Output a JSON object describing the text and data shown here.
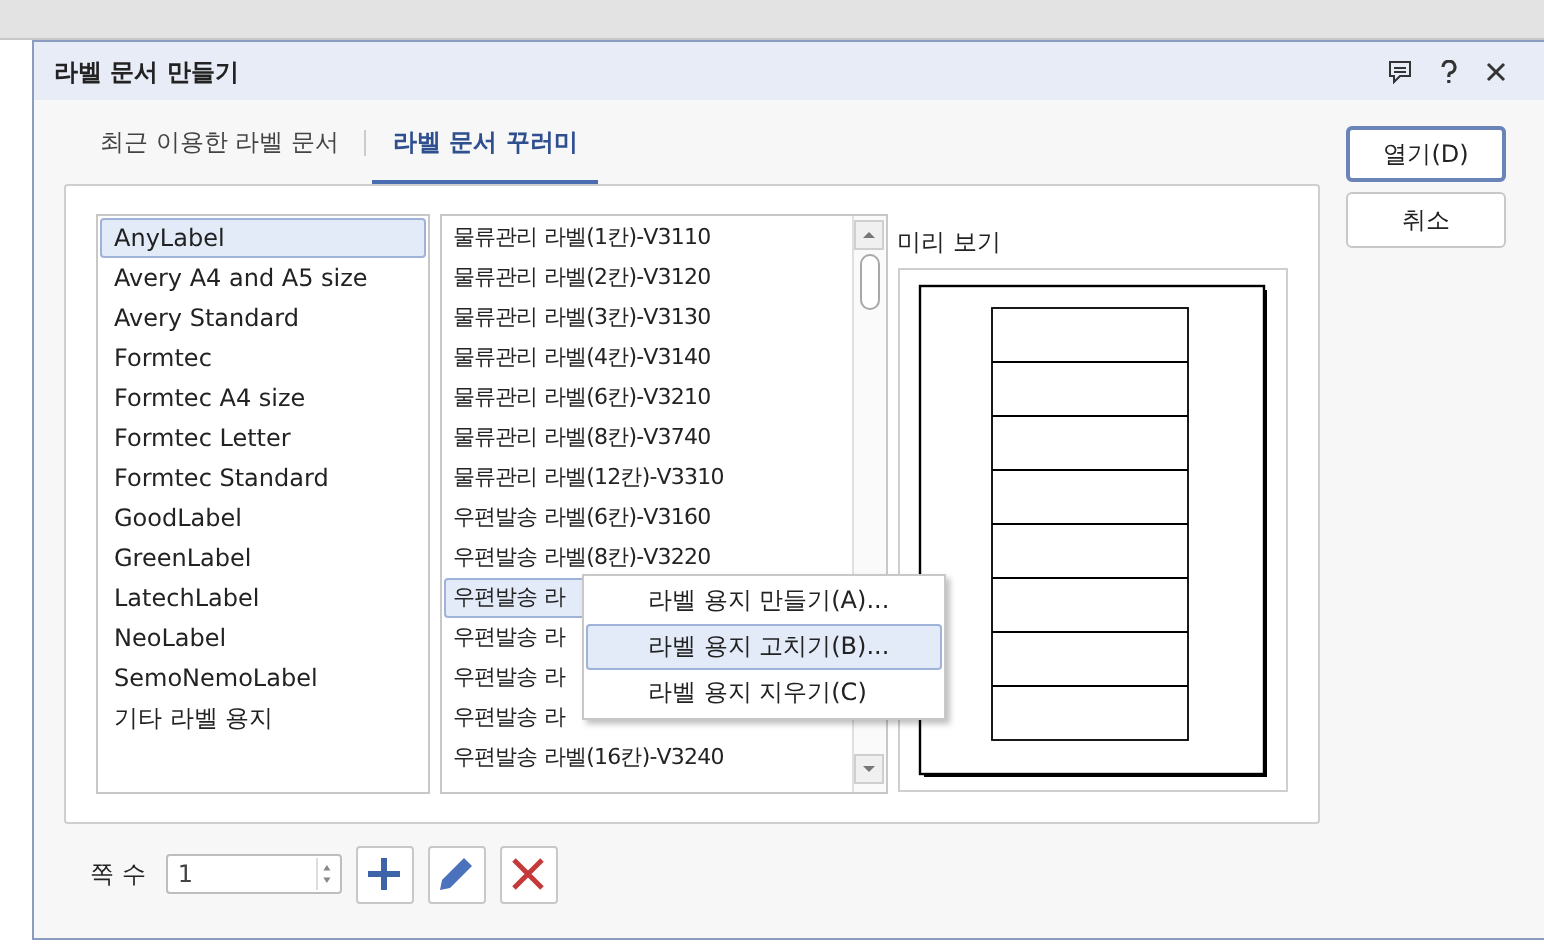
{
  "window": {
    "title": "라벨 문서 만들기"
  },
  "tabs": [
    {
      "label": "최근 이용한 라벨 문서",
      "selected": false
    },
    {
      "label": "라벨 문서 꾸러미",
      "selected": true
    }
  ],
  "makers": [
    {
      "label": "AnyLabel",
      "selected": true
    },
    {
      "label": "Avery A4 and A5 size",
      "selected": false
    },
    {
      "label": "Avery Standard",
      "selected": false
    },
    {
      "label": "Formtec",
      "selected": false
    },
    {
      "label": "Formtec A4 size",
      "selected": false
    },
    {
      "label": "Formtec Letter",
      "selected": false
    },
    {
      "label": "Formtec Standard",
      "selected": false
    },
    {
      "label": "GoodLabel",
      "selected": false
    },
    {
      "label": "GreenLabel",
      "selected": false
    },
    {
      "label": "LatechLabel",
      "selected": false
    },
    {
      "label": "NeoLabel",
      "selected": false
    },
    {
      "label": "SemoNemoLabel",
      "selected": false
    },
    {
      "label": "기타 라벨 용지",
      "selected": false
    }
  ],
  "labels": [
    {
      "label": "물류관리 라벨(1칸)-V3110",
      "selected": false
    },
    {
      "label": "물류관리 라벨(2칸)-V3120",
      "selected": false
    },
    {
      "label": "물류관리 라벨(3칸)-V3130",
      "selected": false
    },
    {
      "label": "물류관리 라벨(4칸)-V3140",
      "selected": false
    },
    {
      "label": "물류관리 라벨(6칸)-V3210",
      "selected": false
    },
    {
      "label": "물류관리 라벨(8칸)-V3740",
      "selected": false
    },
    {
      "label": "물류관리 라벨(12칸)-V3310",
      "selected": false
    },
    {
      "label": "우편발송 라벨(6칸)-V3160",
      "selected": false
    },
    {
      "label": "우편발송 라벨(8칸)-V3220",
      "selected": false
    },
    {
      "label": "우편발송 라",
      "selected": true
    },
    {
      "label": "우편발송 라",
      "selected": false
    },
    {
      "label": "우편발송 라",
      "selected": false
    },
    {
      "label": "우편발송 라",
      "selected": false
    },
    {
      "label": "우편발송 라벨(16칸)-V3240",
      "selected": false
    }
  ],
  "context_menu": [
    {
      "label": "라벨 용지 만들기(A)...",
      "selected": false
    },
    {
      "label": "라벨 용지 고치기(B)...",
      "selected": true
    },
    {
      "label": "라벨 용지 지우기(C)",
      "selected": false
    }
  ],
  "preview": {
    "title": "미리 보기"
  },
  "buttons": [
    {
      "label": "열기(D)",
      "kind": "default"
    },
    {
      "label": "취소",
      "kind": "normal"
    }
  ],
  "pages": {
    "label": "쪽 수",
    "value": "1"
  }
}
